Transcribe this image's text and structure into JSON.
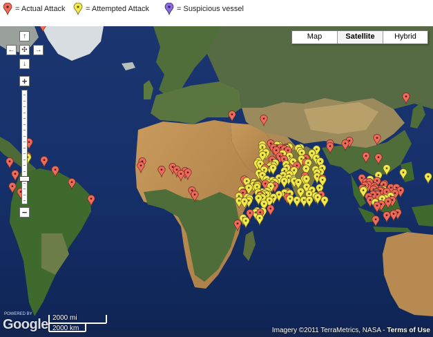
{
  "legend": {
    "items": [
      {
        "label": "= Actual Attack",
        "color": "#f06a5a",
        "icon": "red-pin-icon"
      },
      {
        "label": "= Attempted Attack",
        "color": "#f3e94a",
        "icon": "yellow-pin-icon"
      },
      {
        "label": "= Suspicious vessel",
        "color": "#8a6ae0",
        "icon": "purple-pin-icon"
      }
    ]
  },
  "map_type": {
    "buttons": [
      "Map",
      "Satellite",
      "Hybrid"
    ],
    "selected": "Satellite"
  },
  "controls": {
    "pan_up": "↑",
    "pan_left": "←",
    "pan_center": "✣",
    "pan_right": "→",
    "pan_down": "↓",
    "zoom_in": "+",
    "zoom_out": "−",
    "zoom_level_fraction": 0.82
  },
  "footer": {
    "logo_text": "Google",
    "powered_by": "POWERED BY",
    "scale_mi": "2000 mi",
    "scale_km": "2000 km",
    "copyright": "Imagery ©2011 TerraMetrics, NASA - ",
    "terms": "Terms of Use"
  },
  "colors": {
    "ocean": "#152b5e",
    "actual": "#f06a5a",
    "attempted": "#f3e94a",
    "suspicious": "#8a6ae0"
  }
}
